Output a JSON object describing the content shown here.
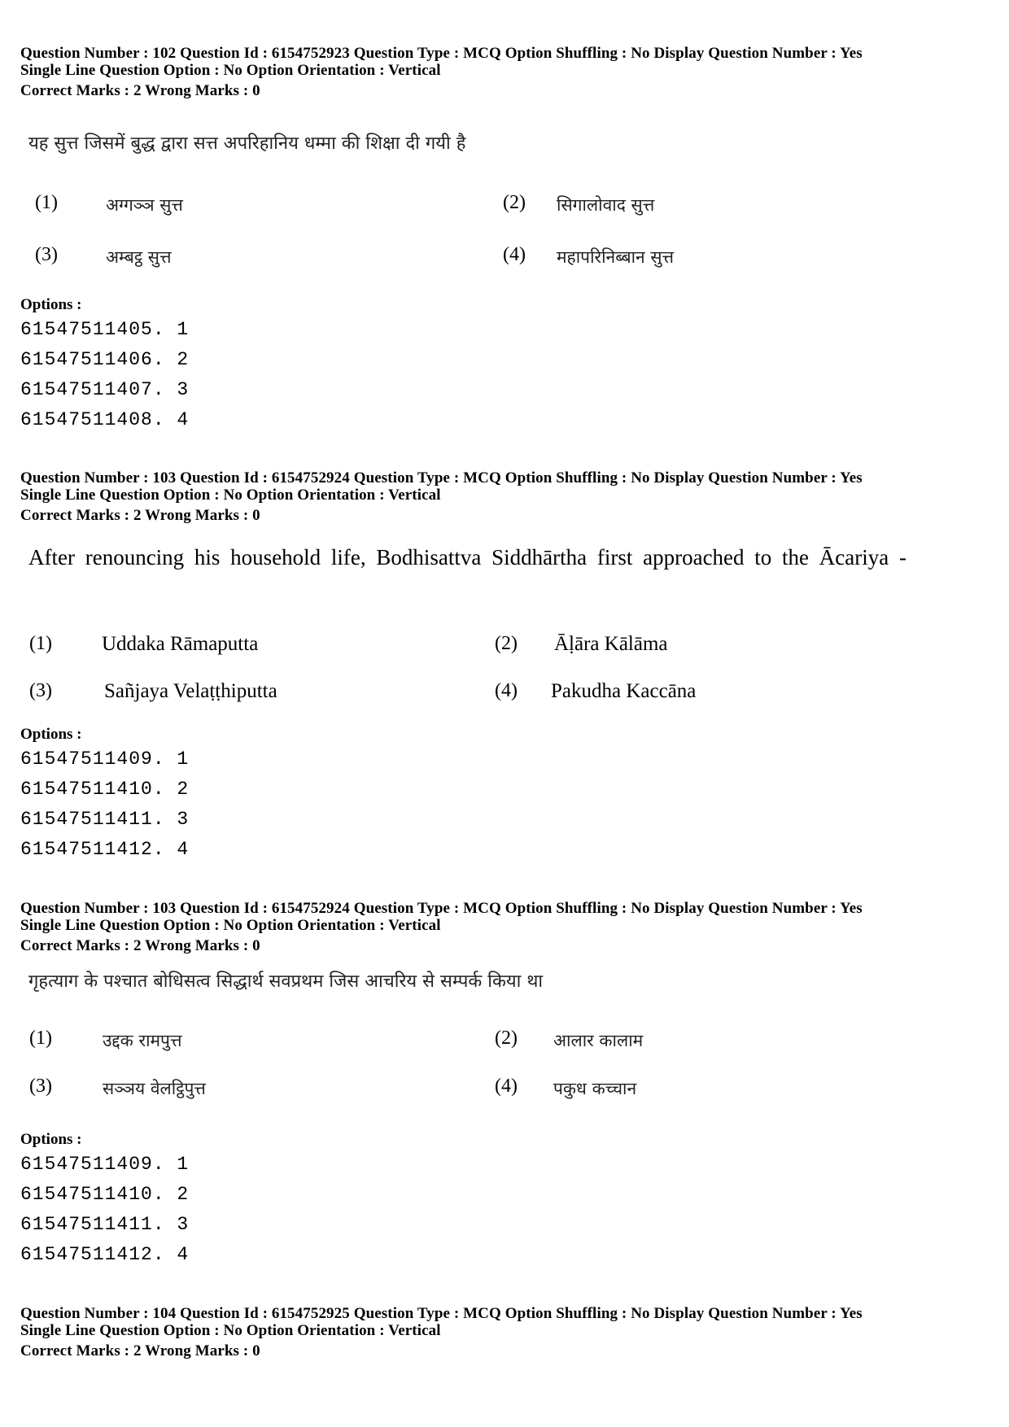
{
  "questions": [
    {
      "meta_line1": "Question Number : 102  Question Id : 6154752923  Question Type : MCQ  Option Shuffling : No  Display Question Number : Yes",
      "meta_line2": "Single Line Question Option : No  Option Orientation : Vertical",
      "marks": "Correct Marks : 2  Wrong Marks : 0",
      "question_text": "यह सुत्त जिसमें बुद्ध द्वारा सत्त अपरिहानिय धम्मा की शिक्षा दी गयी है",
      "choices": [
        {
          "num": "(1)",
          "text": "अग्गञ्ञ सुत्त"
        },
        {
          "num": "(2)",
          "text": "सिगालोवाद सुत्त"
        },
        {
          "num": "(3)",
          "text": "अम्बट्ठ सुत्त"
        },
        {
          "num": "(4)",
          "text": "महापरिनिब्बान सुत्त"
        }
      ],
      "options_label": "Options :",
      "option_ids": [
        "61547511405. 1",
        "61547511406. 2",
        "61547511407. 3",
        "61547511408. 4"
      ]
    },
    {
      "meta_line1": "Question Number : 103  Question Id : 6154752924  Question Type : MCQ  Option Shuffling : No  Display Question Number : Yes",
      "meta_line2": "Single Line Question Option : No  Option Orientation : Vertical",
      "marks": "Correct Marks : 2  Wrong Marks : 0",
      "question_text": "After renouncing his household life, Bodhisattva Siddhārtha first approached to the Ācariya -",
      "choices": [
        {
          "num": "(1)",
          "text": "Uddaka Rāmaputta"
        },
        {
          "num": "(2)",
          "text": "Āḷāra Kālāma"
        },
        {
          "num": "(3)",
          "text": "Sañjaya  Velaṭṭhiputta"
        },
        {
          "num": "(4)",
          "text": "Pakudha Kaccāna"
        }
      ],
      "options_label": "Options :",
      "option_ids": [
        "61547511409. 1",
        "61547511410. 2",
        "61547511411. 3",
        "61547511412. 4"
      ]
    },
    {
      "meta_line1": "Question Number : 103  Question Id : 6154752924  Question Type : MCQ  Option Shuffling : No  Display Question Number : Yes",
      "meta_line2": "Single Line Question Option : No  Option Orientation : Vertical",
      "marks": "Correct Marks : 2  Wrong Marks : 0",
      "question_text": "गृहत्याग के पश्चात बोधिसत्व सिद्धार्थ सवप्रथम जिस आचरिय से सम्पर्क किया था",
      "choices": [
        {
          "num": "(1)",
          "text": "उद्दक रामपुत्त"
        },
        {
          "num": "(2)",
          "text": "आलार कालाम"
        },
        {
          "num": "(3)",
          "text": "सञ्ञय वेलट्ठिपुत्त"
        },
        {
          "num": "(4)",
          "text": "पकुध कच्चान"
        }
      ],
      "options_label": "Options :",
      "option_ids": [
        "61547511409. 1",
        "61547511410. 2",
        "61547511411. 3",
        "61547511412. 4"
      ]
    },
    {
      "meta_line1": "Question Number : 104  Question Id : 6154752925  Question Type : MCQ  Option Shuffling : No  Display Question Number : Yes",
      "meta_line2": "Single Line Question Option : No  Option Orientation : Vertical",
      "marks": "Correct Marks : 2  Wrong Marks : 0"
    }
  ]
}
